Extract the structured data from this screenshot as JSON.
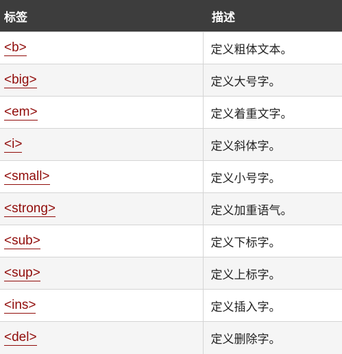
{
  "table": {
    "headers": [
      "标签",
      "描述"
    ],
    "rows": [
      {
        "tag": "<b>",
        "desc": "定义粗体文本。"
      },
      {
        "tag": "<big>",
        "desc": "定义大号字。"
      },
      {
        "tag": "<em>",
        "desc": "定义着重文字。"
      },
      {
        "tag": "<i>",
        "desc": "定义斜体字。"
      },
      {
        "tag": "<small>",
        "desc": "定义小号字。"
      },
      {
        "tag": "<strong>",
        "desc": "定义加重语气。"
      },
      {
        "tag": "<sub>",
        "desc": "定义下标字。"
      },
      {
        "tag": "<sup>",
        "desc": "定义上标字。"
      },
      {
        "tag": "<ins>",
        "desc": "定义插入字。"
      },
      {
        "tag": "<del>",
        "desc": "定义删除字。"
      }
    ]
  },
  "colors": {
    "header_bg": "#3d3d3d",
    "header_text": "#ffffff",
    "link": "#900b09",
    "row_alt": "#f5f5f5",
    "border": "#d4d4d4"
  }
}
